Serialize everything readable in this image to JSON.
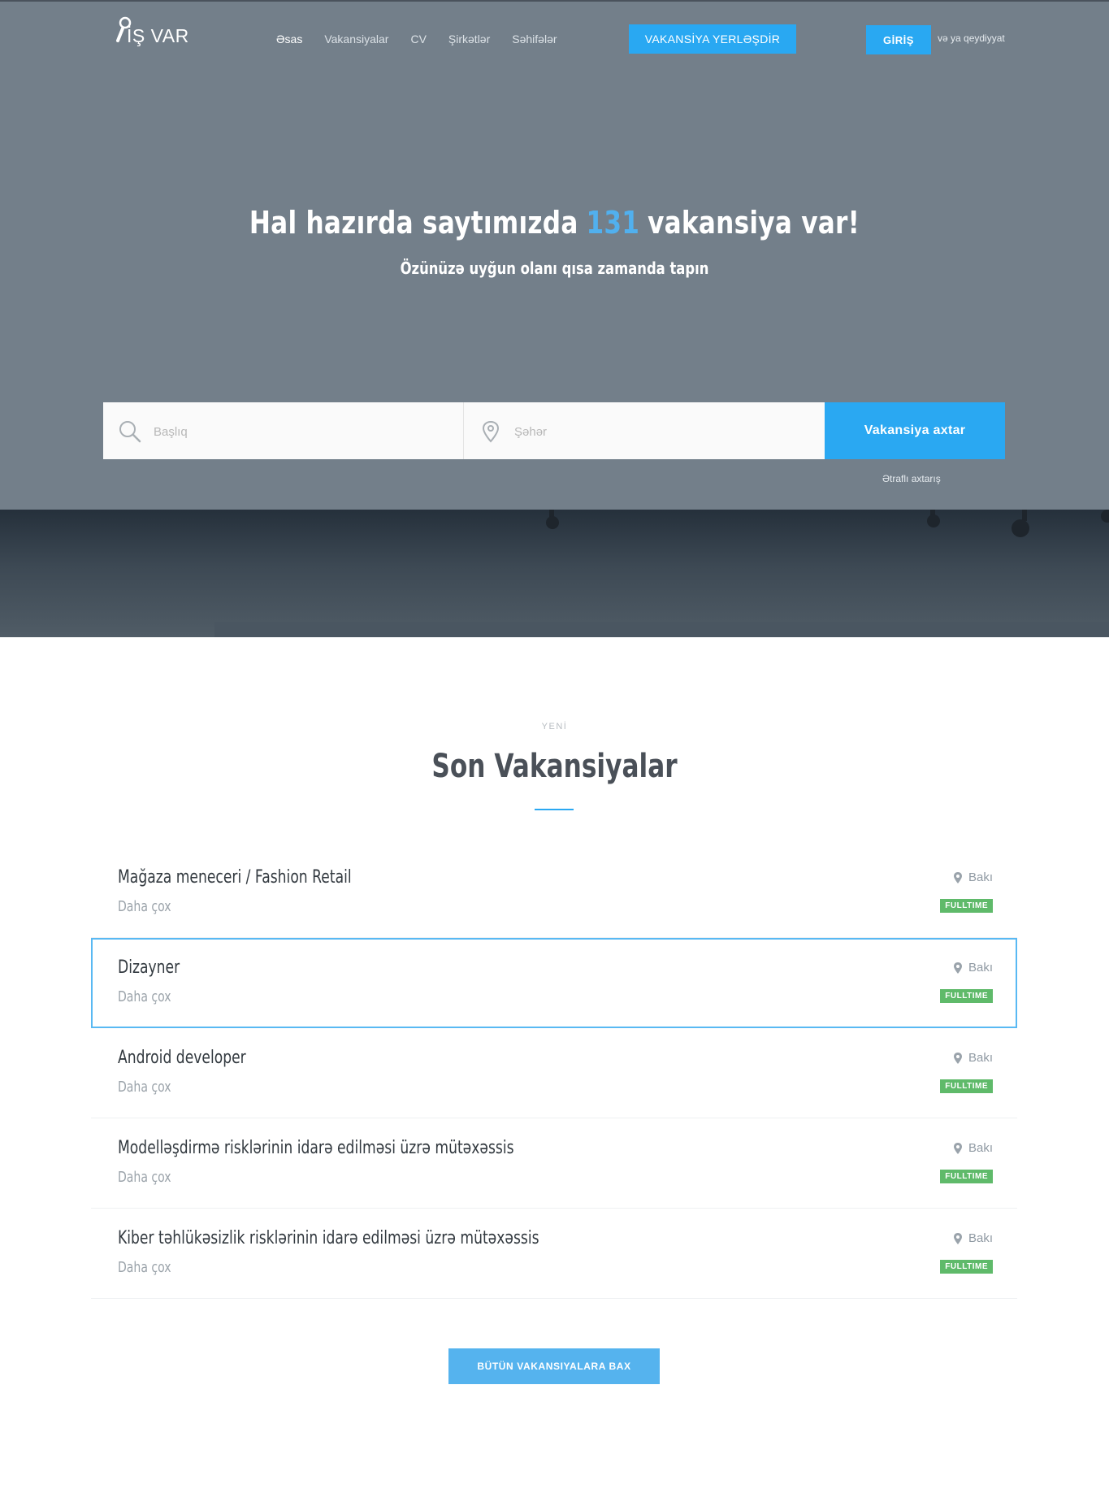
{
  "header": {
    "logo_text": "İŞ VAR",
    "nav": [
      "Əsas",
      "Vakansiyalar",
      "CV",
      "Şirkətlər",
      "Səhifələr"
    ],
    "post_button": "VAKANSİYA YERLƏŞDİR",
    "login_button": "GİRİŞ",
    "register_text": "və ya qeydiyyat"
  },
  "hero": {
    "title_before": "Hal hazırda saytımızda",
    "count": "131",
    "title_after": "vakansiya var!",
    "subtitle": "Özünüzə uyğun olanı qısa zamanda tapın"
  },
  "search": {
    "title_placeholder": "Başlıq",
    "city_placeholder": "Şəhər",
    "button": "Vakansiya axtar",
    "advanced": "Ətraflı axtarış"
  },
  "section": {
    "kicker": "YENİ",
    "title": "Son Vakansiyalar"
  },
  "jobs": [
    {
      "title": "Mağaza meneceri / Fashion Retail",
      "more": "Daha çox",
      "city": "Bakı",
      "type": "FULLTIME"
    },
    {
      "title": "Dizayner",
      "more": "Daha çox",
      "city": "Bakı",
      "type": "FULLTIME"
    },
    {
      "title": "Android developer",
      "more": "Daha çox",
      "city": "Bakı",
      "type": "FULLTIME"
    },
    {
      "title": "Modelləşdirmə risklərinin idarə edilməsi üzrə mütəxəssis",
      "more": "Daha çox",
      "city": "Bakı",
      "type": "FULLTIME"
    },
    {
      "title": "Kiber təhlükəsizlik risklərinin idarə edilməsi üzrə mütəxəssis",
      "more": "Daha çox",
      "city": "Bakı",
      "type": "FULLTIME"
    }
  ],
  "all_button": "BÜTÜN VAKANSIYALARA BAX",
  "colors": {
    "accent": "#29a8f2",
    "badge": "#5fba6a",
    "hero_bg": "#737f8a"
  },
  "icons": [
    "magnifier-key-logo-icon",
    "search-icon",
    "map-pin-icon"
  ]
}
